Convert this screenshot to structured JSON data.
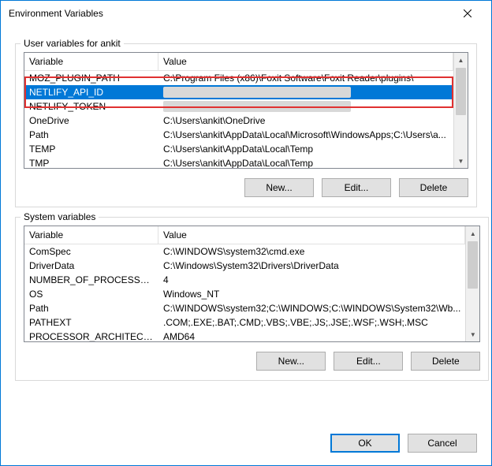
{
  "window": {
    "title": "Environment Variables",
    "close_icon": "close"
  },
  "user_section": {
    "label": "User variables for ankit",
    "headers": {
      "variable": "Variable",
      "value": "Value"
    },
    "rows": [
      {
        "variable": "MOZ_PLUGIN_PATH",
        "value": "C:\\Program Files (x86)\\Foxit Software\\Foxit Reader\\plugins\\"
      },
      {
        "variable": "NETLIFY_API_ID",
        "value": ""
      },
      {
        "variable": "NETLIFY_TOKEN",
        "value": ""
      },
      {
        "variable": "OneDrive",
        "value": "C:\\Users\\ankit\\OneDrive"
      },
      {
        "variable": "Path",
        "value": "C:\\Users\\ankit\\AppData\\Local\\Microsoft\\WindowsApps;C:\\Users\\a..."
      },
      {
        "variable": "TEMP",
        "value": "C:\\Users\\ankit\\AppData\\Local\\Temp"
      },
      {
        "variable": "TMP",
        "value": "C:\\Users\\ankit\\AppData\\Local\\Temp"
      }
    ],
    "buttons": {
      "new": "New...",
      "edit": "Edit...",
      "delete": "Delete"
    }
  },
  "system_section": {
    "label": "System variables",
    "headers": {
      "variable": "Variable",
      "value": "Value"
    },
    "rows": [
      {
        "variable": "ComSpec",
        "value": "C:\\WINDOWS\\system32\\cmd.exe"
      },
      {
        "variable": "DriverData",
        "value": "C:\\Windows\\System32\\Drivers\\DriverData"
      },
      {
        "variable": "NUMBER_OF_PROCESSORS",
        "value": "4"
      },
      {
        "variable": "OS",
        "value": "Windows_NT"
      },
      {
        "variable": "Path",
        "value": "C:\\WINDOWS\\system32;C:\\WINDOWS;C:\\WINDOWS\\System32\\Wb..."
      },
      {
        "variable": "PATHEXT",
        "value": ".COM;.EXE;.BAT;.CMD;.VBS;.VBE;.JS;.JSE;.WSF;.WSH;.MSC"
      },
      {
        "variable": "PROCESSOR_ARCHITECTURE",
        "value": "AMD64"
      }
    ],
    "buttons": {
      "new": "New...",
      "edit": "Edit...",
      "delete": "Delete"
    }
  },
  "footer": {
    "ok": "OK",
    "cancel": "Cancel"
  }
}
